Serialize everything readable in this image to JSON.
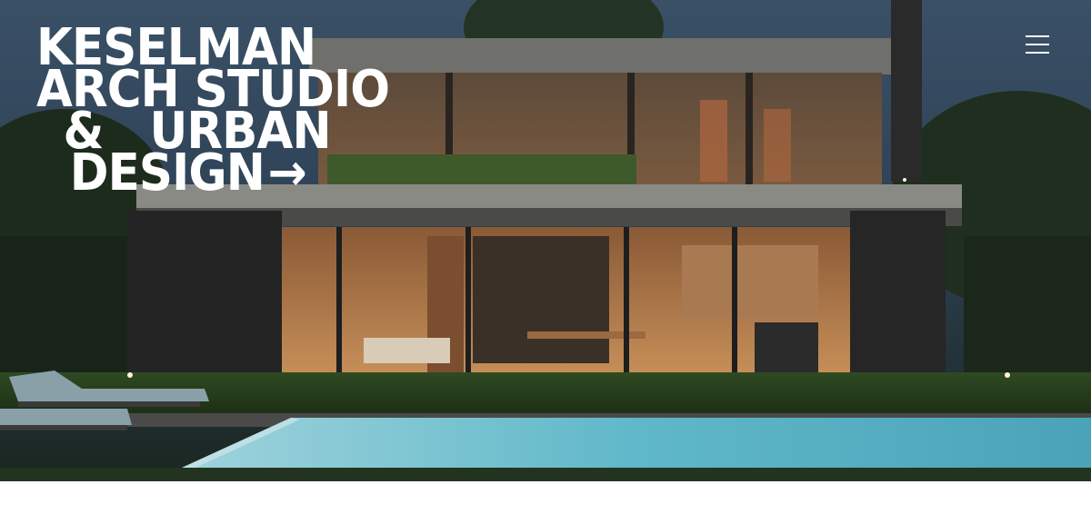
{
  "brand": {
    "line1": "KESELMAN",
    "line2": "ARCH STUDIO",
    "line3": "&   URBAN",
    "line4": "DESIGN",
    "arrow": "→"
  },
  "menu": {
    "icon": "hamburger-icon"
  },
  "colors": {
    "text": "#ffffff",
    "sky": "#34495c",
    "pool": "#5fb8c9",
    "interior_light": "#c98a55",
    "page_bg": "#ffffff"
  }
}
